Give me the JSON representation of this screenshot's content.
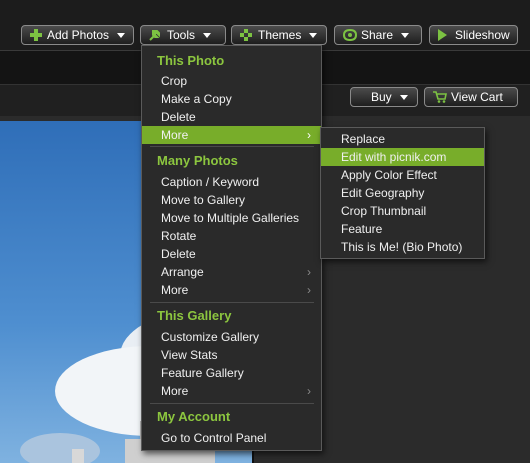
{
  "toolbar": {
    "add_photos": "Add Photos",
    "tools": "Tools",
    "themes": "Themes",
    "share": "Share",
    "slideshow": "Slideshow"
  },
  "photo_toolbar": {
    "buy": "Buy",
    "view_cart": "View Cart"
  },
  "tools_menu": {
    "this_photo": {
      "header": "This Photo",
      "items": [
        "Crop",
        "Make a Copy",
        "Delete",
        "More"
      ]
    },
    "many_photos": {
      "header": "Many Photos",
      "items": [
        "Caption / Keyword",
        "Move to Gallery",
        "Move to Multiple Galleries",
        "Rotate",
        "Delete",
        "Arrange",
        "More"
      ]
    },
    "this_gallery": {
      "header": "This Gallery",
      "items": [
        "Customize Gallery",
        "View Stats",
        "Feature Gallery",
        "More"
      ]
    },
    "my_account": {
      "header": "My Account",
      "items": [
        "Go to Control Panel"
      ]
    }
  },
  "more_submenu": {
    "items": [
      "Replace",
      "Edit with picnik.com",
      "Apply Color Effect",
      "Edit Geography",
      "Crop Thumbnail",
      "Feature",
      "This is Me! (Bio Photo)"
    ],
    "highlighted": "Edit with picnik.com"
  },
  "colors": {
    "accent": "#8cc63f",
    "highlight": "#78ad2a"
  }
}
